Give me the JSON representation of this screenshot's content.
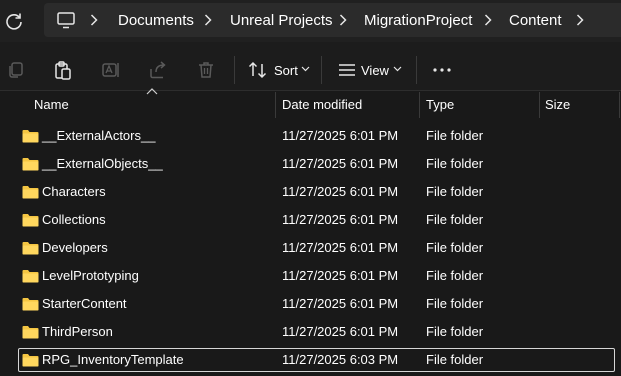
{
  "breadcrumb": {
    "items": [
      "Documents",
      "Unreal Projects",
      "MigrationProject",
      "Content"
    ]
  },
  "toolbar": {
    "sort_label": "Sort",
    "view_label": "View"
  },
  "columns": {
    "name": "Name",
    "date_modified": "Date modified",
    "type": "Type",
    "size": "Size"
  },
  "files": [
    {
      "name": "__ExternalActors__",
      "date": "11/27/2025 6:01 PM",
      "type": "File folder"
    },
    {
      "name": "__ExternalObjects__",
      "date": "11/27/2025 6:01 PM",
      "type": "File folder"
    },
    {
      "name": "Characters",
      "date": "11/27/2025 6:01 PM",
      "type": "File folder"
    },
    {
      "name": "Collections",
      "date": "11/27/2025 6:01 PM",
      "type": "File folder"
    },
    {
      "name": "Developers",
      "date": "11/27/2025 6:01 PM",
      "type": "File folder"
    },
    {
      "name": "LevelPrototyping",
      "date": "11/27/2025 6:01 PM",
      "type": "File folder"
    },
    {
      "name": "StarterContent",
      "date": "11/27/2025 6:01 PM",
      "type": "File folder"
    },
    {
      "name": "ThirdPerson",
      "date": "11/27/2025 6:01 PM",
      "type": "File folder"
    },
    {
      "name": "RPG_InventoryTemplate",
      "date": "11/27/2025 6:03 PM",
      "type": "File folder"
    }
  ],
  "selected_row": "RPG_InventoryTemplate",
  "colors": {
    "background": "#191919",
    "address_bar": "#2b2b2b",
    "folder": "#f4c542",
    "disabled_icon": "#5a5a5a"
  }
}
